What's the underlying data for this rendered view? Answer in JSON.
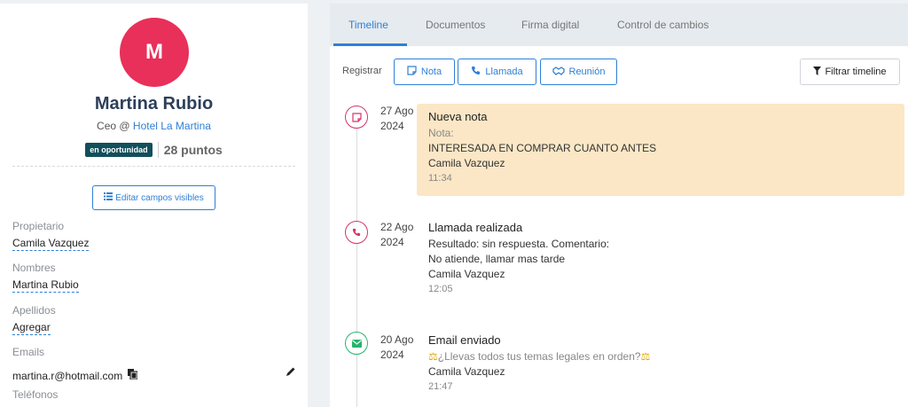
{
  "contact": {
    "avatar_letter": "M",
    "name": "Martina Rubio",
    "role_prefix": "Ceo @",
    "company": "Hotel La Martina",
    "status_badge": "en oportunidad",
    "points": "28 puntos",
    "edit_fields_label": "Editar campos visibles"
  },
  "fields": {
    "owner_label": "Propietario",
    "owner_value": "Camila Vazquez",
    "first_names_label": "Nombres",
    "first_names_value": "Martina Rubio",
    "last_names_label": "Apellidos",
    "last_names_value": "Agregar",
    "emails_label": "Emails",
    "email_value": "martina.r@hotmail.com",
    "phones_label": "Teléfonos"
  },
  "tabs": [
    {
      "label": "Timeline",
      "active": true
    },
    {
      "label": "Documentos",
      "active": false
    },
    {
      "label": "Firma digital",
      "active": false
    },
    {
      "label": "Control de cambios",
      "active": false
    }
  ],
  "register": {
    "label": "Registrar",
    "note": "Nota",
    "call": "Llamada",
    "meeting": "Reunión",
    "filter": "Filtrar timeline"
  },
  "timeline": [
    {
      "type": "note",
      "icon": "note-icon",
      "date_day": "27 Ago",
      "date_year": "2024",
      "title": "Nueva nota",
      "label": "Nota:",
      "text": "INTERESADA EN COMPRAR CUANTO ANTES",
      "author": "Camila Vazquez",
      "time": "11:34"
    },
    {
      "type": "call",
      "icon": "phone-icon",
      "date_day": "22 Ago",
      "date_year": "2024",
      "title": "Llamada realizada",
      "line1": "Resultado: sin respuesta.   Comentario:",
      "line2": "No atiende, llamar mas tarde",
      "author": "Camila Vazquez",
      "time": "12:05"
    },
    {
      "type": "email",
      "icon": "envelope-icon",
      "date_day": "20 Ago",
      "date_year": "2024",
      "title": "Email enviado",
      "subject": "¿Llevas todos tus temas legales en orden?",
      "author": "Camila Vazquez",
      "time": "21:47"
    }
  ],
  "colors": {
    "accent": "#2f7fd6",
    "avatar": "#e8305a",
    "note_bg": "#fbe7c6",
    "badge": "#114f5a"
  }
}
